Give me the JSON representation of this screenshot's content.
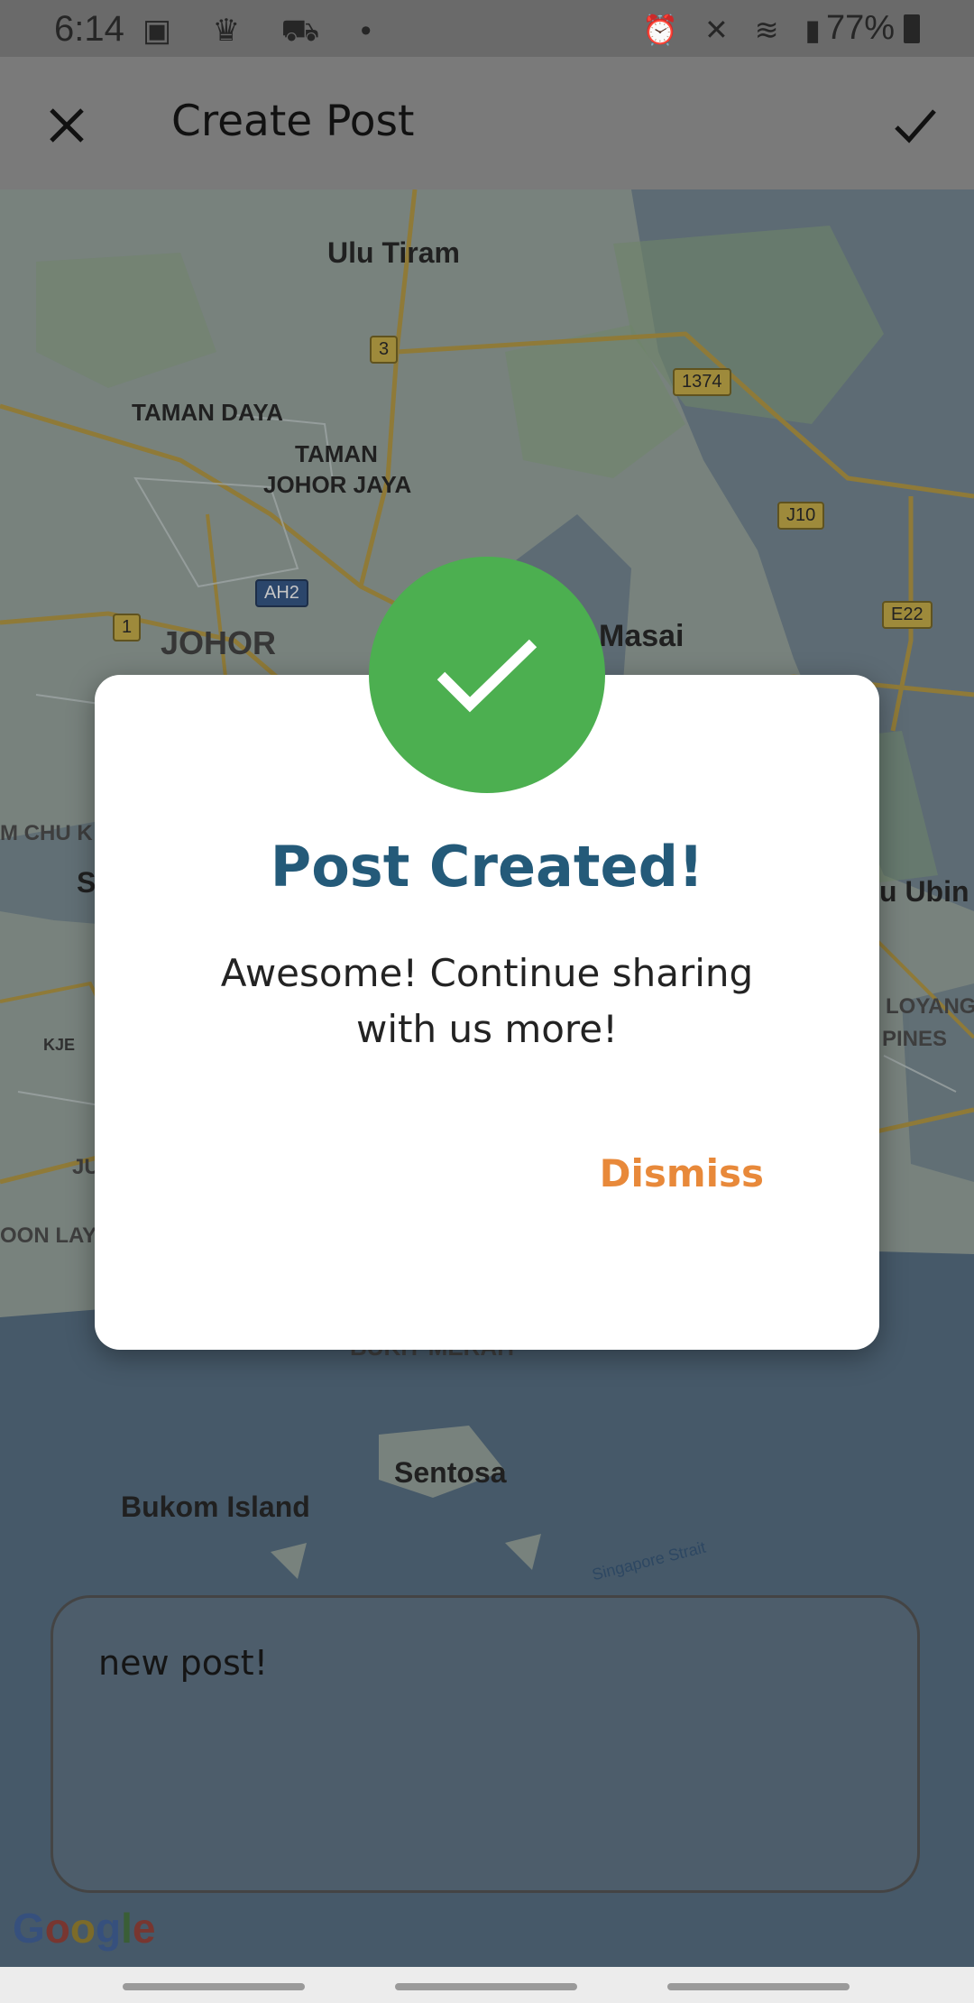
{
  "status_bar": {
    "time": "6:14",
    "left_icons": [
      "gallery-icon",
      "app-icon",
      "cart-icon",
      "dot-icon"
    ],
    "right_icons": [
      "alarm-icon",
      "mute-icon",
      "wifi-icon",
      "signal-icon"
    ],
    "battery": "77%"
  },
  "app_bar": {
    "title": "Create Post",
    "close_icon": "close-icon",
    "confirm_icon": "check-icon"
  },
  "map": {
    "labels": {
      "ulu_tiram": "Ulu Tiram",
      "taman_daya": "TAMAN DAYA",
      "taman_johor_1": "TAMAN",
      "taman_johor_2": "JOHOR JAYA",
      "johor": "JOHOR",
      "masai": "Masai",
      "chu_k": "M CHU K",
      "s_label": "S",
      "ubin": "u Ubin",
      "loyang": "LOYANG",
      "pines": "PINES",
      "kje": "KJE",
      "ju": "JU",
      "oon_lay": "OON LAY",
      "bukit_merah": "BUKIT MERAH",
      "sentosa": "Sentosa",
      "bukom": "Bukom Island",
      "strait": "Singapore Strait"
    },
    "shields": {
      "r3": "3",
      "r1374": "1374",
      "j10": "J10",
      "ah2": "AH2",
      "r1": "1",
      "e22": "E22"
    },
    "google": "Google"
  },
  "post": {
    "text": "new post!"
  },
  "dialog": {
    "title": "Post Created!",
    "message": "Awesome! Continue sharing with us more!",
    "dismiss_label": "Dismiss",
    "accent": "#4caf50",
    "title_color": "#245a79",
    "dismiss_color": "#e8893a"
  }
}
